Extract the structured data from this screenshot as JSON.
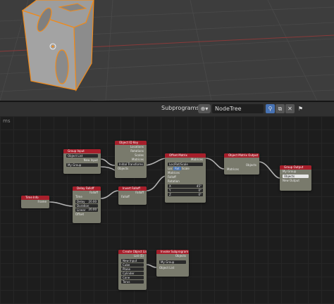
{
  "header": {
    "title": "Subprograms",
    "tree_name": "NodeTree",
    "selector_icon": "node-tree-icon"
  },
  "editor": {
    "label": "ms"
  },
  "nodes": {
    "group_input": {
      "title": "Group Input",
      "rows": [
        "Object List",
        "New Input",
        "My Group"
      ]
    },
    "object_id_key": {
      "title": "Object ID Key",
      "rows": [
        "Locations",
        "Rotations",
        "Scales",
        "Matrices",
        "Initial Transforms",
        "Objects"
      ]
    },
    "offset_matrix": {
      "title": "Offset Matrix",
      "rows": [
        "Matrices",
        "Loc/Rot/Scale",
        "Loc",
        "Rot",
        "Scale",
        "Matrices",
        "Falloff",
        "Rotation",
        "X",
        "Y",
        "Z"
      ],
      "values": [
        "45°",
        "0°",
        "0°"
      ]
    },
    "object_matrix_output": {
      "title": "Object Matrix Output",
      "rows": [
        "Objects",
        "Matrices"
      ]
    },
    "group_output": {
      "title": "Group Output",
      "rows": [
        "My Group",
        "Objects",
        "New Output"
      ]
    },
    "time_info": {
      "title": "Time Info",
      "rows": [
        "Frame"
      ]
    },
    "delay_falloff": {
      "title": "Delay Falloff",
      "rows": [
        "Falloff",
        "Time",
        "Delay",
        "Duration",
        "Linear",
        "Offset"
      ],
      "values": [
        "20.00",
        "20.00"
      ]
    },
    "invert_falloff": {
      "title": "Invert Falloff",
      "rows": [
        "Falloff",
        "Falloff"
      ]
    },
    "create_object_list": {
      "title": "Create Object List",
      "rows": [
        "List (5)",
        "New Input",
        "Cube",
        "Plane",
        "Cylinder",
        "Cone",
        "Torus"
      ]
    },
    "invoke_subprogram": {
      "title": "Invoke Subprogram",
      "rows": [
        "Objects",
        "My Group",
        "Object List"
      ]
    }
  }
}
